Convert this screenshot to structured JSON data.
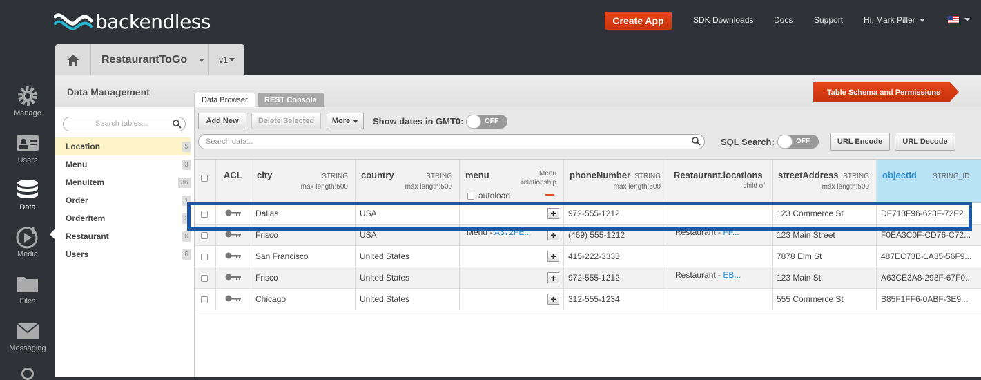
{
  "topbar": {
    "brand": "backendless",
    "create_app": "Create App",
    "links": [
      "SDK Downloads",
      "Docs",
      "Support"
    ],
    "user": "Hi, Mark Piller"
  },
  "leftnav": [
    {
      "label": "Manage",
      "icon": "gear-icon"
    },
    {
      "label": "Users",
      "icon": "users-icon"
    },
    {
      "label": "Data",
      "icon": "database-icon"
    },
    {
      "label": "Media",
      "icon": "media-icon"
    },
    {
      "label": "Files",
      "icon": "folder-icon"
    },
    {
      "label": "Messaging",
      "icon": "envelope-icon"
    }
  ],
  "appbar": {
    "app_name": "RestaurantToGo",
    "version": "v1"
  },
  "section_title": "Data Management",
  "tabs": [
    "Data Browser",
    "REST Console"
  ],
  "schema_button": "Table Schema and Permissions",
  "sidebar": {
    "search_placeholder": "Search tables...",
    "tables": [
      {
        "name": "Location",
        "count": "5"
      },
      {
        "name": "Menu",
        "count": "3"
      },
      {
        "name": "MenuItem",
        "count": "36"
      },
      {
        "name": "Order",
        "count": "1"
      },
      {
        "name": "OrderItem",
        "count": "3"
      },
      {
        "name": "Restaurant",
        "count": "6"
      },
      {
        "name": "Users",
        "count": "6"
      }
    ]
  },
  "toolbar": {
    "add_new": "Add New",
    "delete_selected": "Delete Selected",
    "more": "More",
    "show_dates_label": "Show dates in GMT0:",
    "toggle_off": "OFF",
    "search_placeholder": "Search data...",
    "sql_label": "SQL Search:",
    "url_encode": "URL Encode",
    "url_decode": "URL Decode"
  },
  "columns": [
    {
      "name": "ACL",
      "type": "",
      "sub": ""
    },
    {
      "name": "city",
      "type": "STRING",
      "sub": "max length:500"
    },
    {
      "name": "country",
      "type": "STRING",
      "sub": "max length:500"
    },
    {
      "name": "menu",
      "type": "Menu",
      "sub": "relationship",
      "extra": "autoload"
    },
    {
      "name": "phoneNumber",
      "type": "STRING",
      "sub": "max length:500"
    },
    {
      "name": "Restaurant.locations",
      "type": "",
      "sub": "child of"
    },
    {
      "name": "streetAddress",
      "type": "STRING",
      "sub": "max length:500"
    },
    {
      "name": "objectId",
      "type": "STRING_ID",
      "sub": ""
    }
  ],
  "rows": [
    {
      "city": "Dallas",
      "country": "USA",
      "menu": "",
      "menu_link": "",
      "phone": "972-555-1212",
      "rest": "",
      "rest_link": "",
      "street": "123 Commerce St",
      "objectId": "DF713F96-623F-72F2..."
    },
    {
      "city": "Frisco",
      "country": "USA",
      "menu": "Menu - ",
      "menu_link": "A372FE...",
      "phone": "(469) 555-1212",
      "rest": "Restaurant - ",
      "rest_link": "FF...",
      "street": "123 Main Street",
      "objectId": "F0EA3C0F-CD76-C72..."
    },
    {
      "city": "San Francisco",
      "country": "United States",
      "menu": "",
      "menu_link": "",
      "phone": "415-222-3333",
      "rest": "",
      "rest_link": "",
      "street": "7878 Elm St",
      "objectId": "487EC73B-1A35-56F9..."
    },
    {
      "city": "Frisco",
      "country": "United States",
      "menu": "",
      "menu_link": "",
      "phone": "972-555-1212",
      "rest": "Restaurant - ",
      "rest_link": "EB...",
      "street": "123 Main St.",
      "objectId": "A63CE3A8-293F-67F0..."
    },
    {
      "city": "Chicago",
      "country": "United States",
      "menu": "",
      "menu_link": "",
      "phone": "312-555-1234",
      "rest": "",
      "rest_link": "",
      "street": "555 Commerce St",
      "objectId": "B85F1FF6-0ABF-3E9..."
    }
  ]
}
